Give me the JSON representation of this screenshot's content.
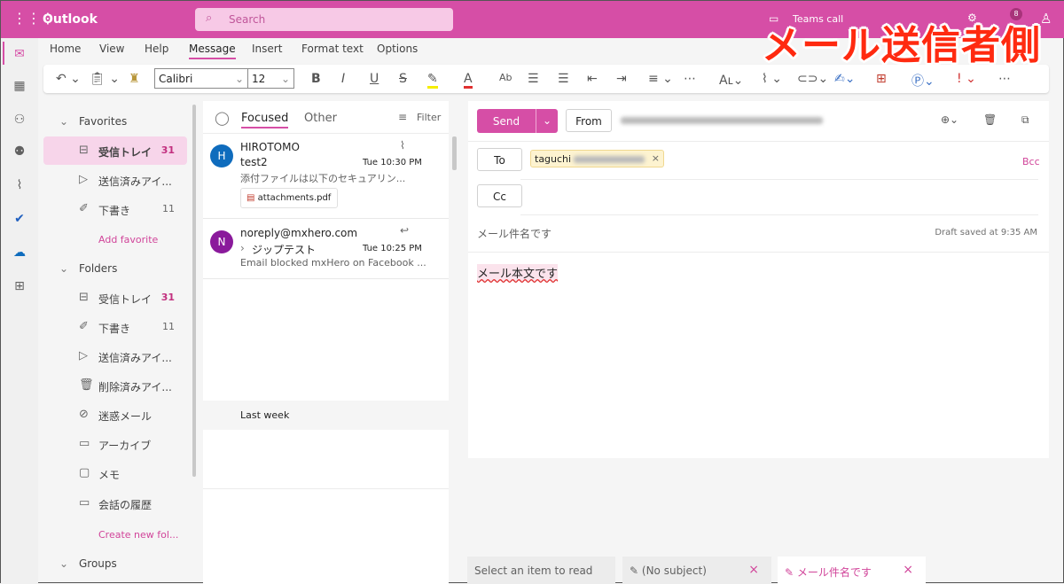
{
  "app": {
    "title": "Outlook",
    "search_placeholder": "Search",
    "teams_call": "Teams call",
    "notification_count": "8"
  },
  "ribbon": {
    "tabs": [
      "Home",
      "View",
      "Help",
      "Message",
      "Insert",
      "Format text",
      "Options"
    ],
    "active": "Message",
    "font": "Calibri",
    "font_size": "12"
  },
  "favorites": {
    "header": "Favorites",
    "items": [
      {
        "label": "受信トレイ",
        "count": "31"
      },
      {
        "label": "送信済みアイ...",
        "count": ""
      },
      {
        "label": "下書き",
        "count": "11"
      }
    ],
    "add": "Add favorite"
  },
  "folders": {
    "header": "Folders",
    "items": [
      {
        "label": "受信トレイ",
        "count": "31"
      },
      {
        "label": "下書き",
        "count": "11"
      },
      {
        "label": "送信済みアイ...",
        "count": ""
      },
      {
        "label": "削除済みアイ...",
        "count": ""
      },
      {
        "label": "迷惑メール",
        "count": ""
      },
      {
        "label": "アーカイブ",
        "count": ""
      },
      {
        "label": "メモ",
        "count": ""
      },
      {
        "label": "会話の履歴",
        "count": ""
      }
    ],
    "create": "Create new fol..."
  },
  "groups_header": "Groups",
  "list": {
    "tabs": [
      "Focused",
      "Other"
    ],
    "filter": "Filter",
    "messages": [
      {
        "initial": "H",
        "sender": "HIROTOMO",
        "subject": "test2",
        "time": "Tue 10:30 PM",
        "preview": "添付ファイルは以下のセキュアリン...",
        "attachment": "attachments.pdf",
        "color": "#0f6cbd"
      },
      {
        "initial": "N",
        "sender": "noreply@mxhero.com",
        "subject": "ジップテスト",
        "time": "Tue 10:25 PM",
        "preview": "Email blocked mxHero on Facebook ...",
        "color": "#8a1a9b"
      }
    ],
    "section": "Last week"
  },
  "compose": {
    "send": "Send",
    "from": "From",
    "to": "To",
    "cc": "Cc",
    "bcc": "Bcc",
    "recipient": "taguchi",
    "subject": "メール件名です",
    "draft_status": "Draft saved at 9:35 AM",
    "body": "メール本文です"
  },
  "bottom_tabs": [
    "Select an item to read",
    "(No subject)",
    "メール件名です"
  ],
  "overlay": "メール送信者側",
  "colors": {
    "brand": "#d64ea6",
    "accent": "#d1459a"
  }
}
